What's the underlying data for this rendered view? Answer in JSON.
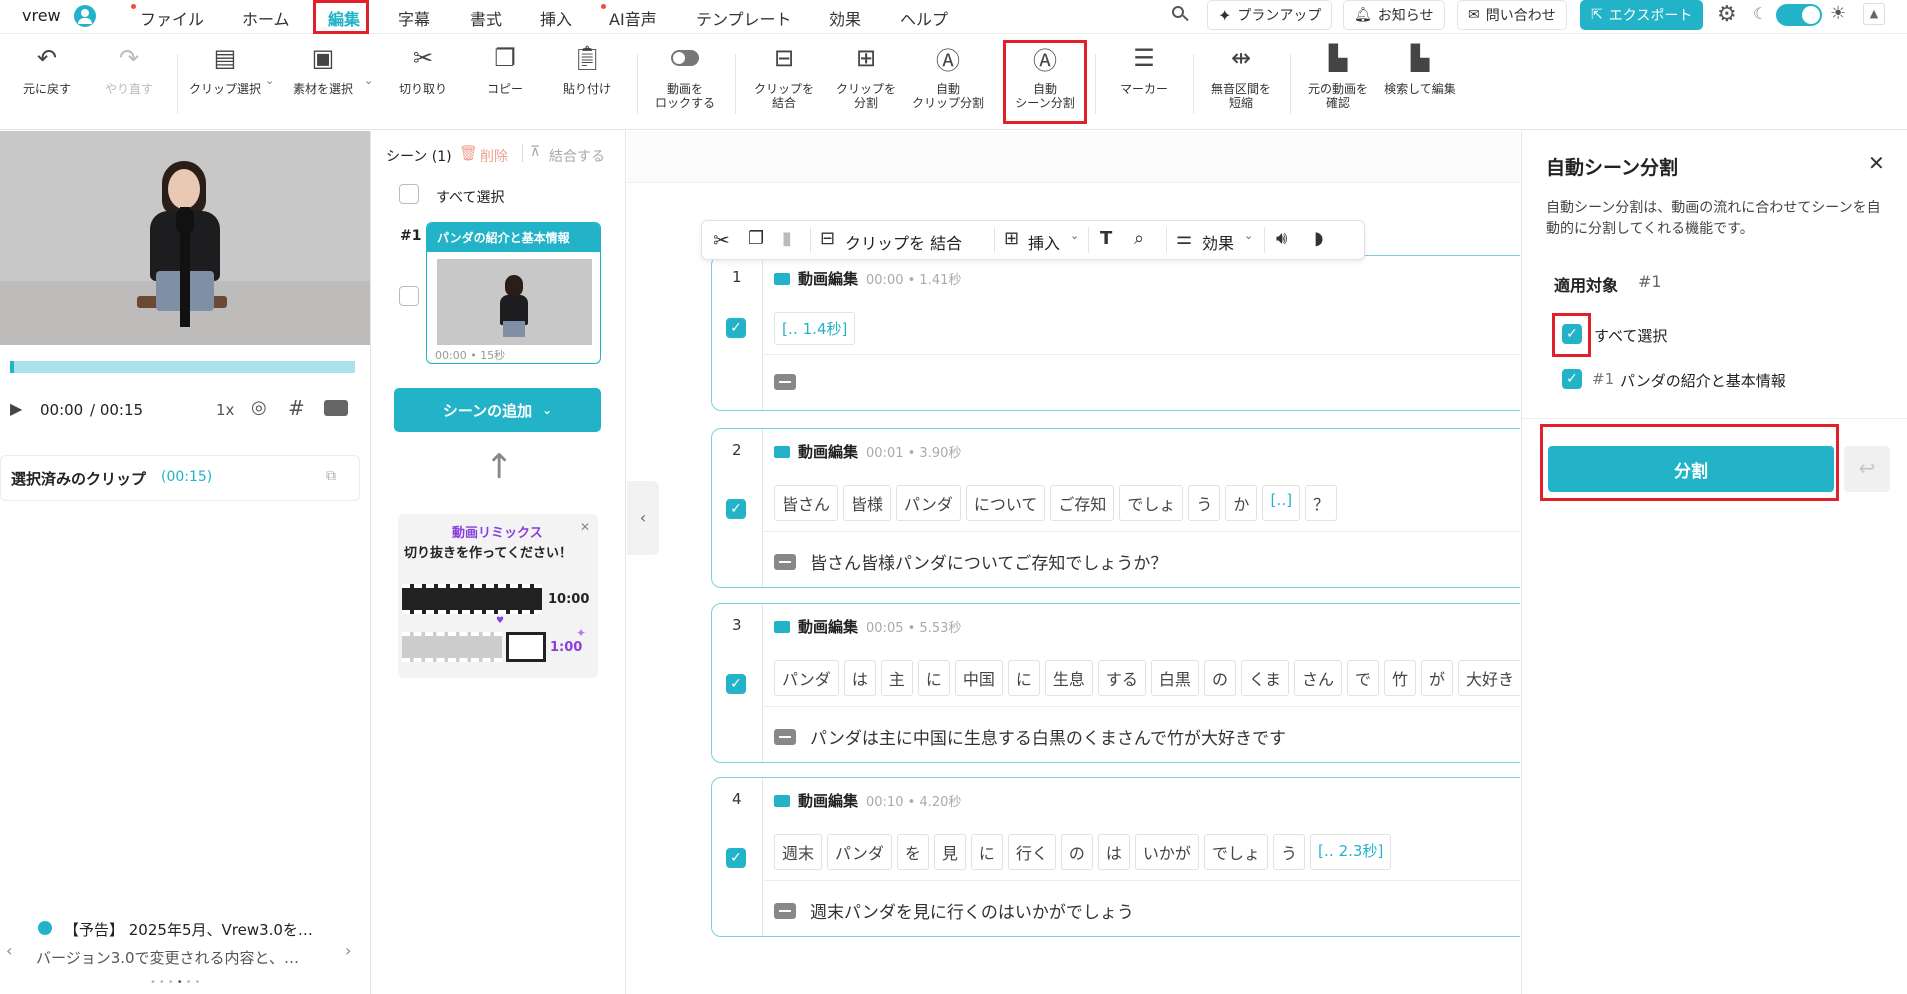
{
  "app": {
    "name": "vrew"
  },
  "menu": {
    "items": [
      "ファイル",
      "ホーム",
      "編集",
      "字幕",
      "書式",
      "挿入",
      "AI音声",
      "テンプレート",
      "効果",
      "ヘルプ"
    ],
    "active": "編集"
  },
  "topright": {
    "plan": "プランアップ",
    "notice": "お知らせ",
    "contact": "問い合わせ",
    "export": "エクスポート"
  },
  "toolbar": {
    "undo": "元に戻す",
    "redo": "やり直す",
    "clip_select": "クリップ選択",
    "material_select": "素材を選択",
    "cut": "切り取り",
    "copy": "コピー",
    "paste": "貼り付け",
    "lock": "動画を\nロックする",
    "merge": "クリップを\n結合",
    "split": "クリップを\n分割",
    "auto_clip_split": "自動\nクリップ分割",
    "auto_scene_split": "自動\nシーン分割",
    "marker": "マーカー",
    "shorten_silence": "無音区間を\n短縮",
    "check_original": "元の動画を\n確認",
    "search_edit": "検索して編集"
  },
  "player": {
    "time_current": "00:00",
    "time_total": "/ 00:15",
    "speed": "1x",
    "progress": 0.01
  },
  "selected_clips": {
    "label": "選択済みのクリップ",
    "duration": "(00:15)"
  },
  "announcement": {
    "title": "【予告】 2025年5月、Vrew3.0を…",
    "body": "バージョン3.0で変更される内容と、…"
  },
  "scenes": {
    "header": "シーン (1)",
    "delete": "削除",
    "combine": "結合する",
    "select_all": "すべて選択",
    "items": [
      {
        "num": "#1",
        "title": "パンダの紹介と基本情報",
        "time": "00:00 • 15秒"
      }
    ],
    "add_scene": "シーンの追加",
    "promo": {
      "title": "動画リミックス",
      "body": "切り抜きを作ってください！",
      "long_time": "10:00",
      "short_time": "1:00"
    }
  },
  "floating_toolbar": {
    "merge": "クリップを 結合",
    "insert": "挿入",
    "effect": "効果"
  },
  "clips": [
    {
      "num": "1",
      "label": "動画編集",
      "time": "00:00 • 1.41秒",
      "words": [
        {
          "t": "[‥ 1.4秒]",
          "sil": true
        }
      ],
      "subtitle": ""
    },
    {
      "num": "2",
      "label": "動画編集",
      "time": "00:01 • 3.90秒",
      "words": [
        {
          "t": "皆さん"
        },
        {
          "t": "皆様"
        },
        {
          "t": "パンダ"
        },
        {
          "t": "について"
        },
        {
          "t": "ご存知"
        },
        {
          "t": "でしょ"
        },
        {
          "t": "う"
        },
        {
          "t": "か"
        },
        {
          "t": "[‥]",
          "sil": true
        },
        {
          "t": "？"
        }
      ],
      "subtitle": "皆さん皆様パンダについてご存知でしょうか？"
    },
    {
      "num": "3",
      "label": "動画編集",
      "time": "00:05 • 5.53秒",
      "words": [
        {
          "t": "パンダ"
        },
        {
          "t": "は"
        },
        {
          "t": "主"
        },
        {
          "t": "に"
        },
        {
          "t": "中国"
        },
        {
          "t": "に"
        },
        {
          "t": "生息"
        },
        {
          "t": "する"
        },
        {
          "t": "白黒"
        },
        {
          "t": "の"
        },
        {
          "t": "くま"
        },
        {
          "t": "さん"
        },
        {
          "t": "で"
        },
        {
          "t": "竹"
        },
        {
          "t": "が"
        },
        {
          "t": "大好き"
        },
        {
          "t": "[‥]",
          "sil": true
        },
        {
          "t": "[？"
        }
      ],
      "subtitle": "パンダは主に中国に生息する白黒のくまさんで竹が大好きです"
    },
    {
      "num": "4",
      "label": "動画編集",
      "time": "00:10 • 4.20秒",
      "words": [
        {
          "t": "週末"
        },
        {
          "t": "パンダ"
        },
        {
          "t": "を"
        },
        {
          "t": "見"
        },
        {
          "t": "に"
        },
        {
          "t": "行く"
        },
        {
          "t": "の"
        },
        {
          "t": "は"
        },
        {
          "t": "いかが"
        },
        {
          "t": "でしょ"
        },
        {
          "t": "う"
        },
        {
          "t": "[‥ 2.3秒]",
          "sil": true
        }
      ],
      "subtitle": "週末パンダを見に行くのはいかがでしょう"
    }
  ],
  "panel": {
    "title": "自動シーン分割",
    "description": "自動シーン分割は、動画の流れに合わせてシーンを自動的に分割してくれる機能です。",
    "target_label": "適用対象",
    "target_num": "#1",
    "select_all": "すべて選択",
    "item_num": "#1",
    "item_title": "パンダの紹介と基本情報",
    "split_button": "分割"
  },
  "colors": {
    "accent": "#22b3c8",
    "highlight": "#e0202a",
    "purple": "#8a3ee0"
  }
}
